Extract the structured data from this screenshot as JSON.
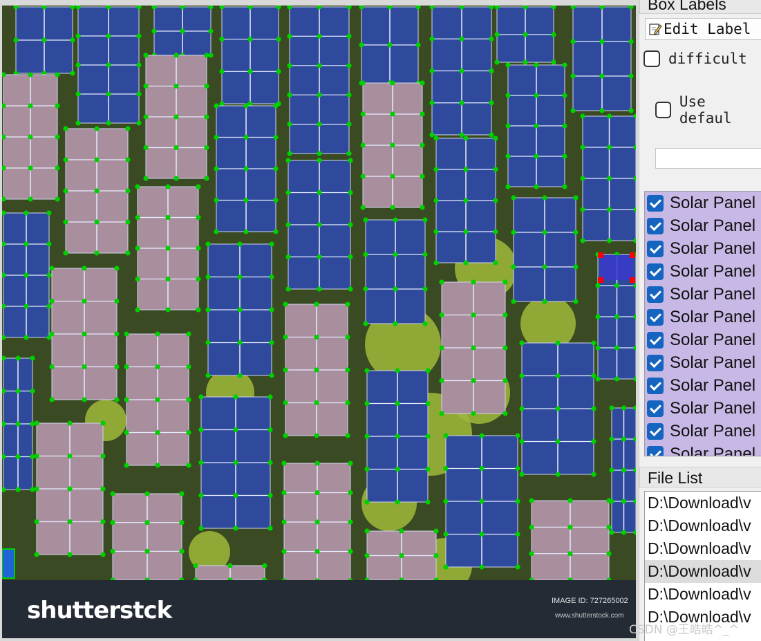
{
  "canvas": {
    "watermark": {
      "logo": "shutterstck",
      "image_id": "IMAGE ID: 727265002",
      "url": "www.shutterstock.com"
    }
  },
  "dock": {
    "box_labels_title": "Box Labels",
    "edit_label_button": "Edit Label",
    "difficult_label": "difficult",
    "use_default_label": "Use defaul",
    "label_list": [
      "Solar Panel",
      "Solar Panel",
      "Solar Panel",
      "Solar Panel",
      "Solar Panel",
      "Solar Panel",
      "Solar Panel",
      "Solar Panel",
      "Solar Panel",
      "Solar Panel",
      "Solar Panel",
      "Solar Panel"
    ],
    "file_list_title": "File List",
    "file_list": [
      "D:\\Download\\v",
      "D:\\Download\\v",
      "D:\\Download\\v",
      "D:\\Download\\v",
      "D:\\Download\\v",
      "D:\\Download\\v"
    ]
  },
  "overlay_watermark": "CSDN @王皓皓^_^",
  "colors": {
    "point": "#00d000",
    "selected_corner": "#ff0000",
    "label_list_bg": "#c7b8e6",
    "check_blue": "#1565c0"
  }
}
